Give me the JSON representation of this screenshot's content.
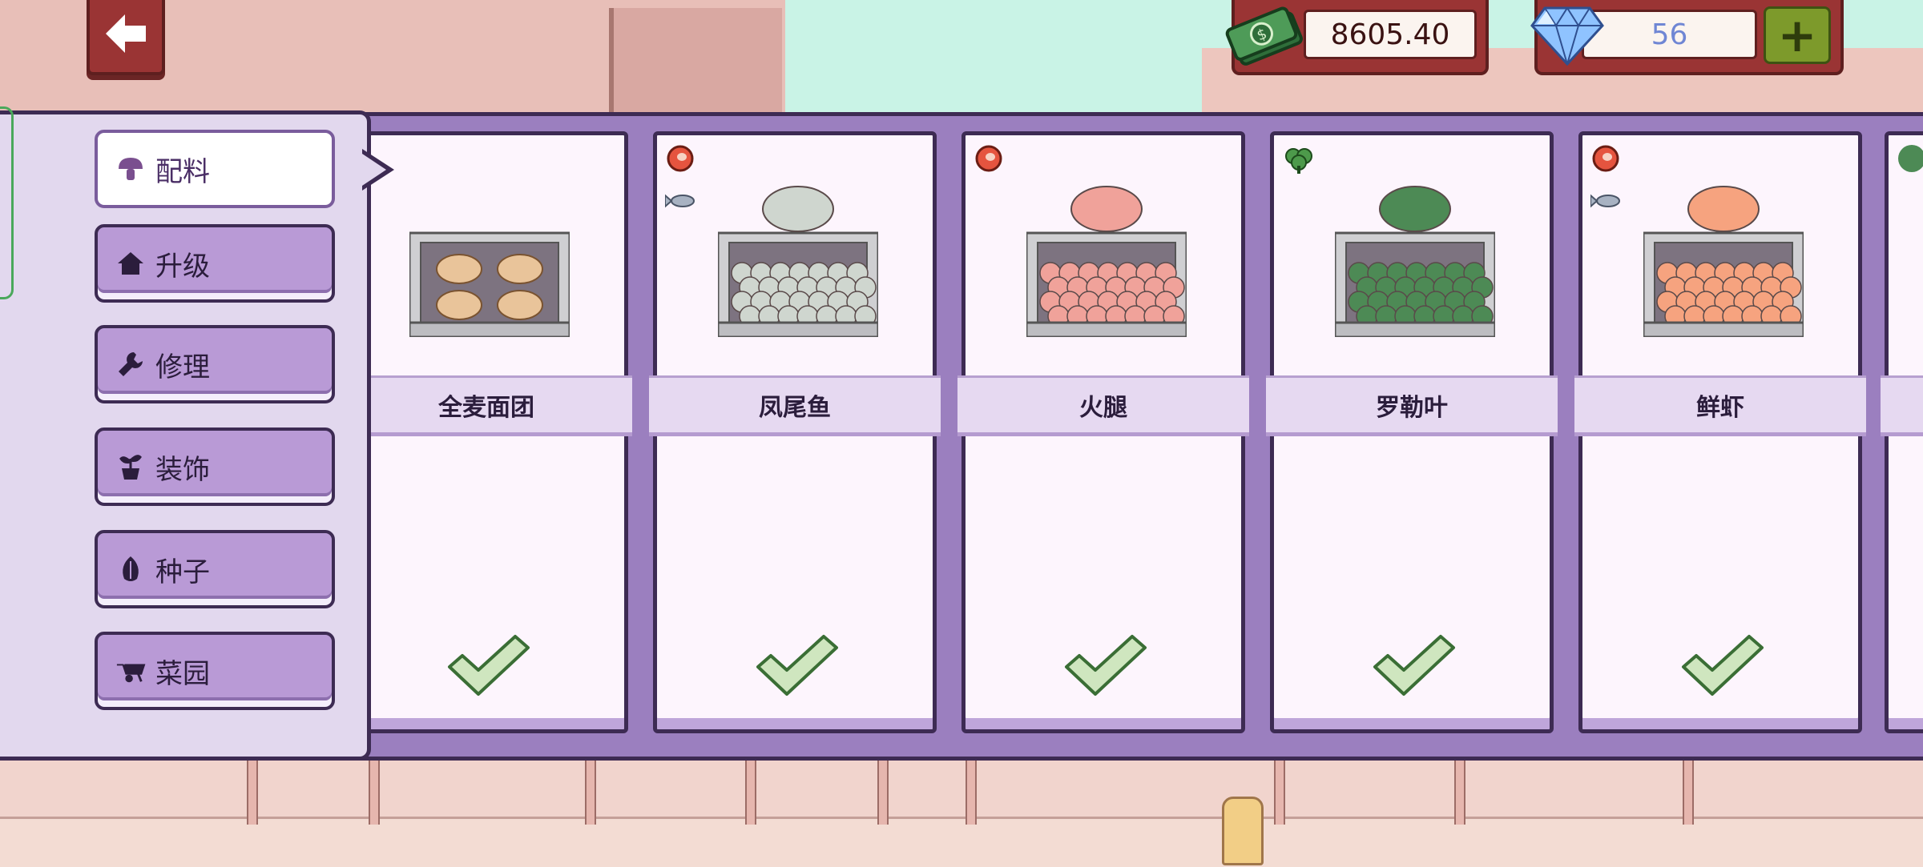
{
  "hud": {
    "money": "8605.40",
    "gems": "56",
    "plus_label": "+"
  },
  "sidebar": {
    "tabs": [
      {
        "label": "配料",
        "icon": "mushroom-icon",
        "active": true
      },
      {
        "label": "升级",
        "icon": "house-icon",
        "active": false
      },
      {
        "label": "修理",
        "icon": "wrench-icon",
        "active": false
      },
      {
        "label": "装饰",
        "icon": "potted-plant-icon",
        "active": false
      },
      {
        "label": "种子",
        "icon": "seed-icon",
        "active": false
      },
      {
        "label": "菜园",
        "icon": "wheelbarrow-icon",
        "active": false
      }
    ]
  },
  "items": [
    {
      "name": "全麦面团",
      "tags": [],
      "status": "owned",
      "color": "#e9c49a"
    },
    {
      "name": "凤尾鱼",
      "tags": [
        "meat-icon",
        "fish-icon"
      ],
      "status": "owned",
      "color": "#cfd6cf"
    },
    {
      "name": "火腿",
      "tags": [
        "meat-icon"
      ],
      "status": "owned",
      "color": "#f0a29a"
    },
    {
      "name": "罗勒叶",
      "tags": [
        "vegetable-icon"
      ],
      "status": "owned",
      "color": "#4d8a55"
    },
    {
      "name": "鲜虾",
      "tags": [
        "meat-icon",
        "fish-icon"
      ],
      "status": "owned",
      "color": "#f6a37f"
    }
  ],
  "colors": {
    "panel": "#9b7fbf",
    "outline": "#3d2b53",
    "check": "#cfe6bf",
    "hud_red": "#9a3434"
  }
}
